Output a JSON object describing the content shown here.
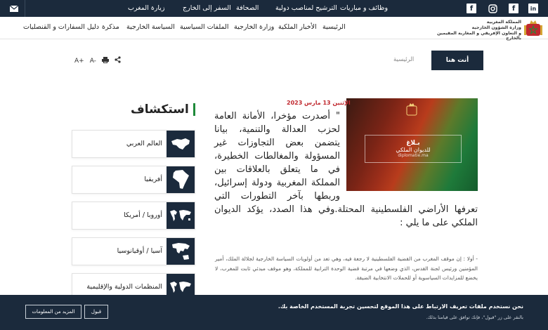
{
  "topbar": {
    "social": [
      "in",
      "f",
      "X",
      "f"
    ],
    "nav": [
      "وظائف و مباريات",
      "الترشيح لمناصب دولية",
      "الصحافة",
      "السفر إلى الخارج",
      "زيارة المغرب"
    ]
  },
  "header": {
    "logo_lines": [
      "المملكة المغربية",
      "وزارة الشؤون الخارجية",
      "و التعاون الإفريقي و المغاربة المقيمين بالخارج"
    ],
    "nav": [
      "الرئيسية",
      "الأخبار الملكية",
      "وزارة الخارجية",
      "الملفات السياسية",
      "السياسة الخارجية",
      "مذكرة",
      "دليل السفارات و القنصليات"
    ]
  },
  "breadcrumb": {
    "you_are_here": "أنت هنا",
    "home": "الرئيسية"
  },
  "tools": {
    "font_up": "A+",
    "font_down": "A-",
    "print_icon": "print-icon",
    "share_icon": "share-icon"
  },
  "article": {
    "date": "الإثنين 13 مارس 2023",
    "hero_lines": [
      "بـلاغ",
      "للديوان الملكي",
      "diplomatie.ma"
    ],
    "lead": "\" أصدرت مؤخرا، الأمانة العامة لحزب العدالة والتنمية، بيانا يتضمن بعض التجاوزات غير المسؤولة والمغالطات الخطيرة، في ما يتعلق بالعلاقات بين المملكة المغربية ودولة إسرائيل، وربطها بآخر التطورات التي تعرفها الأراضي الفلسطينية المحتلة.وفي هذا الصدد، يؤكد الديوان الملكي على ما يلي :",
    "para": "- أولا : إن موقف المغرب من القضية الفلسطينية لا رجعة فيه، وهي تعد من أولويات السياسة الخارجية لجلالة الملك، أمير المؤمنين ورئيس لجنة القدس، الذي وضعها في مرتبة قضية الوحدة الترابية للمملكة، وهو موقف مبدئي ثابت للمغرب، لا يخضع للمزايدات السياسوية أو للحملات الانتخابية الضيقة."
  },
  "explore": {
    "title": "استكشاف",
    "items": [
      {
        "label": "العالم العربي",
        "icon": "arab-world-map-icon"
      },
      {
        "label": "أفريقيا",
        "icon": "africa-map-icon"
      },
      {
        "label": "أوروبا / أمريكا",
        "icon": "world-map-icon"
      },
      {
        "label": "آسيا / أوقيانوسيا",
        "icon": "asia-map-icon"
      },
      {
        "label": "المنظمات الدولية والإقليمية",
        "icon": "world-map-icon"
      }
    ]
  },
  "cookie": {
    "title": "نحن نستخدم ملفات تعريف الارتباط على هذا الموقع لتحسين تجربة المستخدم الخاصة بك.",
    "sub": "بالنقر على زر \"قبول\"، فإنك توافق على قيامنا بذلك.",
    "accept": "قبول",
    "more": "المزيد من المعلومات"
  },
  "colors": {
    "navy": "#1b2a3c",
    "accent_red": "#c0282e",
    "accent_green": "#1f8a3a"
  }
}
